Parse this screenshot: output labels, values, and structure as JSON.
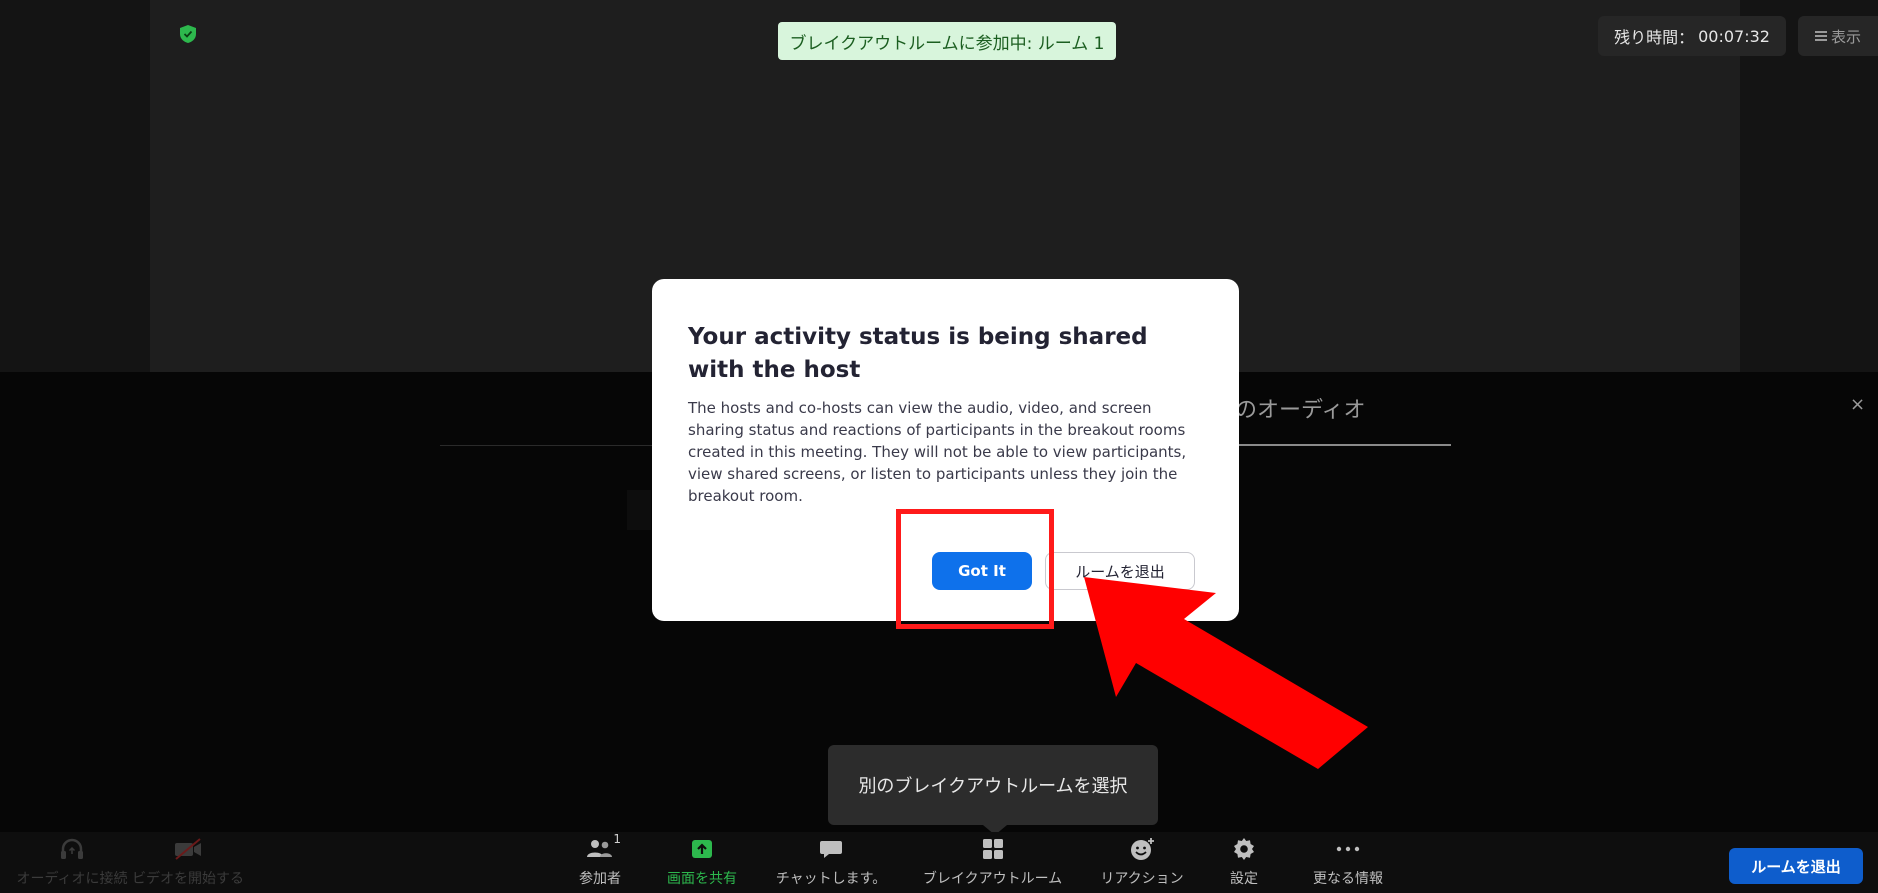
{
  "header": {
    "breakout_banner": "ブレイクアウトルームに参加中: ルーム 1",
    "timer_label": "残り時間：",
    "timer_value": "00:07:32",
    "view_label": "表示"
  },
  "audio_panel": {
    "tab_label": "のオーディオ",
    "close_glyph": "×"
  },
  "modal": {
    "title": "Your activity status is being shared with the host",
    "body": "The hosts and co-hosts can view the audio, video, and screen sharing status and reactions of participants in the breakout rooms created in this meeting. They will not be able to view participants, view shared screens, or listen to participants unless they join the breakout room.",
    "primary_button": "Got It",
    "secondary_button": "ルームを退出"
  },
  "tooltip": {
    "text": "別のブレイクアウトルームを選択"
  },
  "toolbar": {
    "audio_label": "オーディオに接続",
    "video_label": "ビデオを開始する",
    "participants_label": "参加者",
    "participants_count": "1",
    "share_label": "画面を共有",
    "chat_label": "チャットします。",
    "breakout_label": "ブレイクアウトルーム",
    "reactions_label": "リアクション",
    "settings_label": "設定",
    "more_label": "更なる情報",
    "leave_room_label": "ルームを退出"
  },
  "colors": {
    "accent_blue": "#0e71eb",
    "share_green": "#2db84d",
    "annotation_red": "#ff1a1a",
    "banner_bg": "#d8f5dc"
  }
}
